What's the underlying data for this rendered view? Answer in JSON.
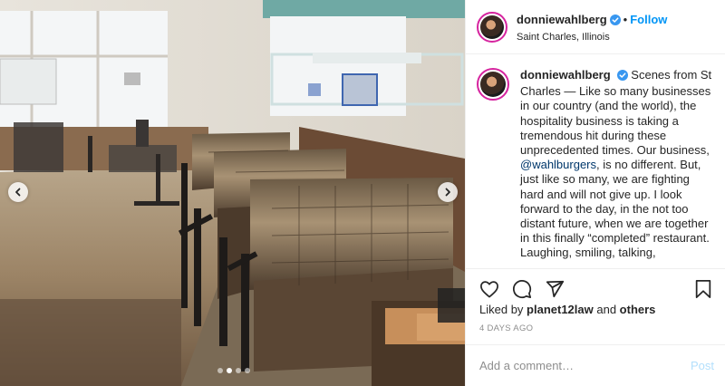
{
  "colors": {
    "accent": "#0095f6",
    "verified": "#3897f0",
    "muted": "#8e8e8e",
    "text": "#262626",
    "post_disabled": "#b2dffc"
  },
  "photo": {
    "description_icon": "restaurant-booths-photo",
    "carousel": {
      "dot_count": 4,
      "active_index": 1
    }
  },
  "header": {
    "username": "donniewahlberg",
    "separator": "•",
    "follow_label": "Follow",
    "location": "Saint Charles, Illinois"
  },
  "caption": {
    "username": "donniewahlberg",
    "text_before_mention": "Scenes from St Charles — Like so many businesses in our country (and the world), the hospitality business is taking a tremendous hit during these unprecedented times. Our business,",
    "mention": "@wahlburgers",
    "text_after_mention": ", is no different. But, just like so many, we are fighting hard and will not give up. I look forward to the day, in the not too distant future, when we are together in this finally “completed” restaurant. Laughing, smiling, talking,"
  },
  "likes": {
    "prefix": "Liked by ",
    "user": "planet12law",
    "middle": " and ",
    "others": "others"
  },
  "time_ago": "4 DAYS AGO",
  "comment": {
    "placeholder": "Add a comment…",
    "post_label": "Post"
  },
  "icons": [
    "chevron-left-icon",
    "chevron-right-icon",
    "verified-badge-icon",
    "heart-icon",
    "comment-icon",
    "share-icon",
    "bookmark-icon"
  ]
}
